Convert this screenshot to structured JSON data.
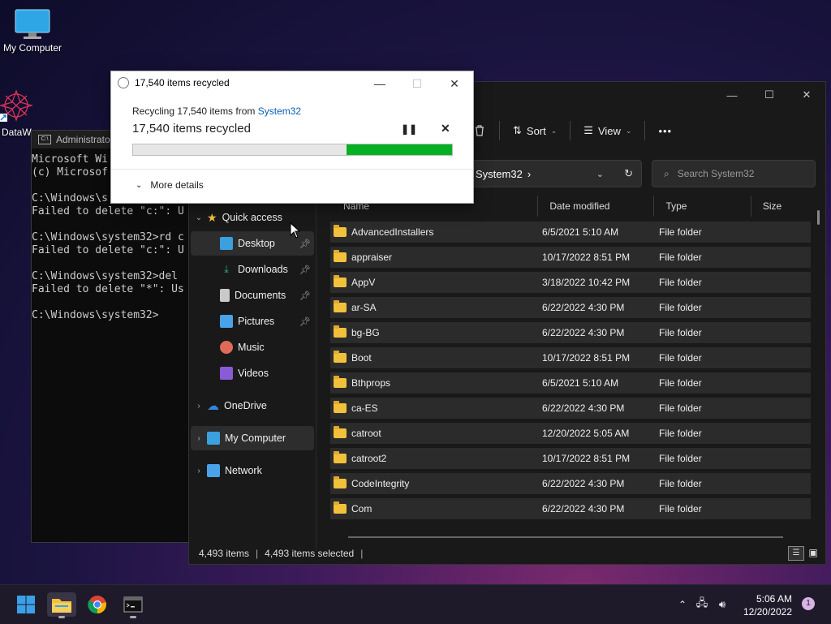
{
  "desktop": {
    "icons": [
      {
        "label": "My Computer"
      },
      {
        "label": "DataW"
      }
    ]
  },
  "cmd": {
    "title": "Administrato",
    "lines": "Microsoft Wi\n(c) Microsof\n\nC:\\Windows\\s\nFailed to delete \"c:\": U\n\nC:\\Windows\\system32>rd c\nFailed to delete \"c:\": U\n\nC:\\Windows\\system32>del\nFailed to delete \"*\": Us\n\nC:\\Windows\\system32>"
  },
  "dialog": {
    "title": "17,540 items recycled",
    "line_prefix": "Recycling 17,540 items from ",
    "line_link": "System32",
    "status": "17,540 items recycled",
    "progress": 0.33,
    "pause": "❚❚",
    "cancel": "✕",
    "more_details": "More details",
    "controls": {
      "minimize": "—",
      "maximize": "☐",
      "close": "✕"
    }
  },
  "explorer": {
    "controls": {
      "minimize": "—",
      "maximize": "☐",
      "close": "✕"
    },
    "toolbar": {
      "sort": "Sort",
      "view": "View",
      "more": "•••"
    },
    "address": "System32",
    "search_placeholder": "Search System32",
    "nav": [
      {
        "label": "Quick access",
        "chev": "⌄",
        "icon": "star-icon",
        "color": "#f2c03b"
      },
      {
        "label": "Desktop",
        "icon": "desktop-icon",
        "color": "#3aa0e0",
        "pinned": true,
        "selected": true
      },
      {
        "label": "Downloads",
        "icon": "download-icon",
        "color": "#33b36b",
        "pinned": true
      },
      {
        "label": "Documents",
        "icon": "documents-icon",
        "color": "#c9c9c9",
        "pinned": true
      },
      {
        "label": "Pictures",
        "icon": "pictures-icon",
        "color": "#4aa3e8",
        "pinned": true
      },
      {
        "label": "Music",
        "icon": "music-icon",
        "color": "#e06a5a"
      },
      {
        "label": "Videos",
        "icon": "videos-icon",
        "color": "#8a5bd6"
      },
      {
        "label": "OneDrive",
        "chev": "›",
        "icon": "onedrive-icon",
        "color": "#2f86d9"
      },
      {
        "label": "My Computer",
        "chev": "›",
        "icon": "computer-icon",
        "color": "#3aa0e0",
        "selected": true
      },
      {
        "label": "Network",
        "chev": "›",
        "icon": "network-icon",
        "color": "#4aa3e8"
      }
    ],
    "columns": [
      "Name",
      "Date modified",
      "Type",
      "Size"
    ],
    "rows": [
      {
        "name": "AdvancedInstallers",
        "date": "6/5/2021 5:10 AM",
        "type": "File folder"
      },
      {
        "name": "appraiser",
        "date": "10/17/2022 8:51 PM",
        "type": "File folder"
      },
      {
        "name": "AppV",
        "date": "3/18/2022 10:42 PM",
        "type": "File folder"
      },
      {
        "name": "ar-SA",
        "date": "6/22/2022 4:30 PM",
        "type": "File folder"
      },
      {
        "name": "bg-BG",
        "date": "6/22/2022 4:30 PM",
        "type": "File folder"
      },
      {
        "name": "Boot",
        "date": "10/17/2022 8:51 PM",
        "type": "File folder"
      },
      {
        "name": "Bthprops",
        "date": "6/5/2021 5:10 AM",
        "type": "File folder"
      },
      {
        "name": "ca-ES",
        "date": "6/22/2022 4:30 PM",
        "type": "File folder"
      },
      {
        "name": "catroot",
        "date": "12/20/2022 5:05 AM",
        "type": "File folder"
      },
      {
        "name": "catroot2",
        "date": "10/17/2022 8:51 PM",
        "type": "File folder"
      },
      {
        "name": "CodeIntegrity",
        "date": "6/22/2022 4:30 PM",
        "type": "File folder"
      },
      {
        "name": "Com",
        "date": "6/22/2022 4:30 PM",
        "type": "File folder"
      }
    ],
    "status_items": "4,493 items",
    "status_selected": "4,493 items selected"
  },
  "taskbar": {
    "time": "5:06 AM",
    "date": "12/20/2022",
    "notifications": "1",
    "colors": {
      "start": "#3aa0e8",
      "explorer": "#f2c03b"
    }
  }
}
